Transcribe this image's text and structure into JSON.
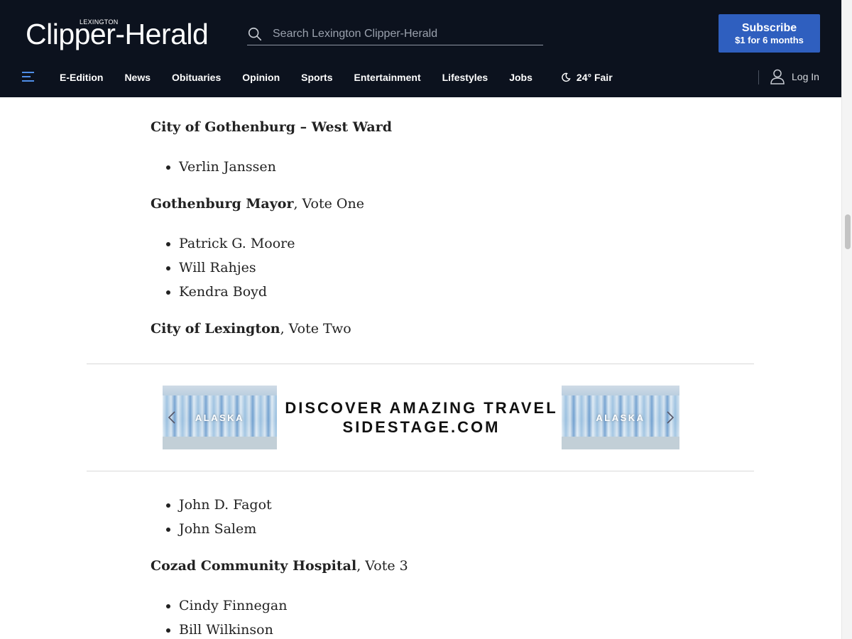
{
  "header": {
    "logo_small": "LEXINGTON",
    "logo_main": "Clipper-Herald",
    "search_placeholder": "Search Lexington Clipper-Herald",
    "subscribe_title": "Subscribe",
    "subscribe_price": "$1 for 6 months",
    "nav_items": [
      "E-Edition",
      "News",
      "Obituaries",
      "Opinion",
      "Sports",
      "Entertainment",
      "Lifestyles",
      "Jobs"
    ],
    "weather": "24° Fair",
    "login": "Log In"
  },
  "article": {
    "heading1": "City of Gothenburg – West Ward",
    "list1": [
      "Verlin Janssen"
    ],
    "heading2_bold": "Gothenburg Mayor",
    "heading2_rest": ", Vote One",
    "list2": [
      "Patrick G. Moore",
      "Will Rahjes",
      "Kendra Boyd"
    ],
    "heading3_bold": "City of Lexington",
    "heading3_rest": ", Vote Two",
    "list3": [
      "John D. Fagot",
      "John Salem"
    ],
    "heading4_bold": "Cozad Community Hospital",
    "heading4_rest": ", Vote 3",
    "list4": [
      "Cindy Finnegan",
      "Bill Wilkinson"
    ]
  },
  "ad": {
    "line1": "DISCOVER AMAZING TRAVEL",
    "line2": "SIDESTAGE.COM",
    "image_label_left": "ALASKA",
    "image_label_right": "ALASKA"
  },
  "colors": {
    "header_bg": "#0c121e",
    "subscribe_bg": "#2f5fbf"
  }
}
